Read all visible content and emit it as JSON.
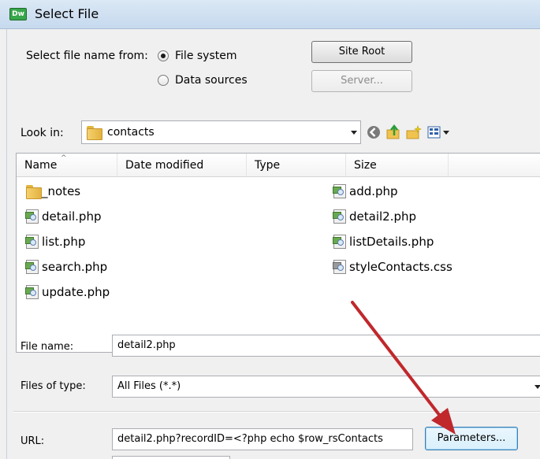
{
  "window": {
    "title": "Select File",
    "app_badge": "Dw"
  },
  "source": {
    "label": "Select file name from:",
    "option_file_system": "File system",
    "option_data_sources": "Data sources",
    "selected": "File system"
  },
  "buttons": {
    "site_root": "Site Root",
    "server": "Server...",
    "parameters": "Parameters..."
  },
  "lookin": {
    "label": "Look in:",
    "folder": "contacts"
  },
  "columns": [
    "Name",
    "Date modified",
    "Type",
    "Size"
  ],
  "files_left": [
    "_notes",
    "detail.php",
    "list.php",
    "search.php",
    "update.php"
  ],
  "files_right": [
    "add.php",
    "detail2.php",
    "listDetails.php",
    "styleContacts.css"
  ],
  "filename": {
    "label": "File name:",
    "value": "detail2.php"
  },
  "filetype": {
    "label": "Files of type:",
    "value": "All Files (*.*)"
  },
  "url": {
    "label": "URL:",
    "value": "detail2.php?recordID=<?php echo $row_rsContacts"
  },
  "colors": {
    "annotation_arrow": "#c0282c",
    "title_bar": "#c6d9ee"
  }
}
